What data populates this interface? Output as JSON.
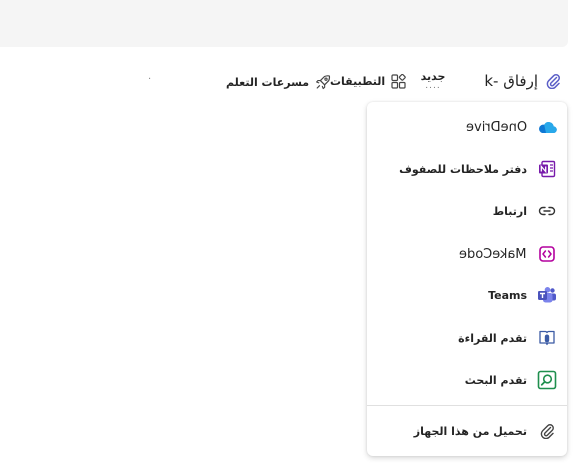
{
  "toolbar": {
    "attach_label": "إرفاق -k",
    "new_label": "جديد",
    "new_more": "....",
    "apps_label": "التطبيقات",
    "accelerators_label": "مسرعات التعلم",
    "separator": "·"
  },
  "menu": {
    "items": [
      {
        "label": "OneDrive",
        "icon": "onedrive-icon"
      },
      {
        "label": "دفتر ملاحظات للصفوف",
        "icon": "class-notebook-icon"
      },
      {
        "label": "ارتباط",
        "icon": "link-icon"
      },
      {
        "label": "MakeCode",
        "icon": "makecode-icon"
      },
      {
        "label": "Teams",
        "icon": "teams-icon"
      },
      {
        "label": "تقدم القراءة",
        "icon": "reading-progress-icon"
      },
      {
        "label": "تقدم البحث",
        "icon": "search-progress-icon"
      }
    ],
    "upload_label": "تحميل من هذا الجهاز"
  },
  "colors": {
    "onedrive": "#0f78d4",
    "onenote": "#7719aa",
    "makecode": "#b4009e",
    "teams": "#5059c9",
    "reading": "#3b5ba5",
    "search": "#1f8f4e"
  }
}
